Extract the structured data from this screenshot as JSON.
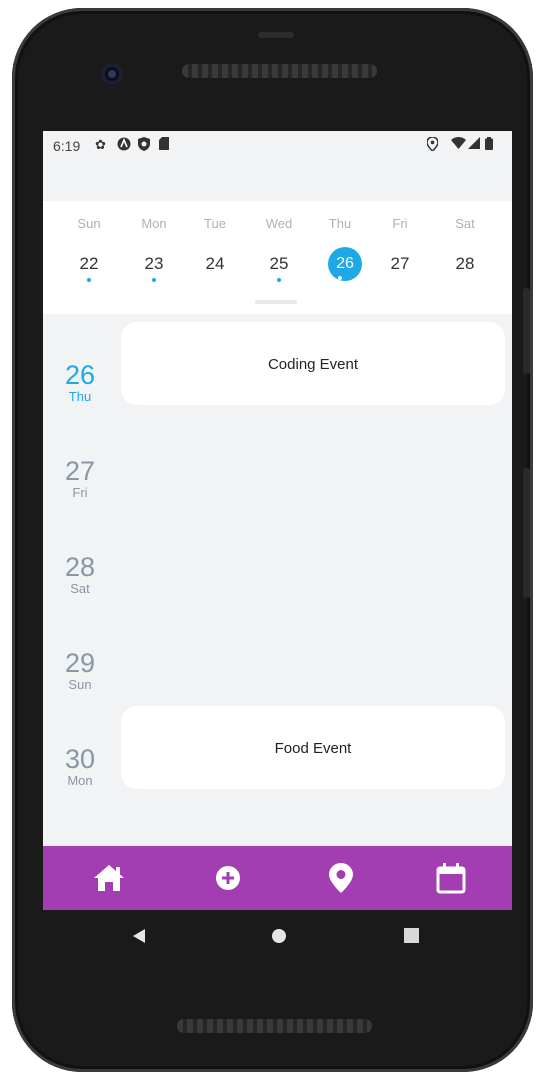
{
  "status_bar": {
    "time": "6:19",
    "left_icons": [
      "settings-icon",
      "notification-a-icon",
      "shield-icon",
      "sd-card-icon"
    ],
    "right_icons": [
      "location-icon",
      "wifi-icon",
      "signal-icon",
      "battery-icon"
    ]
  },
  "week": {
    "days": [
      {
        "dow": "Sun",
        "num": "22",
        "has_event": true,
        "selected": false
      },
      {
        "dow": "Mon",
        "num": "23",
        "has_event": true,
        "selected": false
      },
      {
        "dow": "Tue",
        "num": "24",
        "has_event": false,
        "selected": false
      },
      {
        "dow": "Wed",
        "num": "25",
        "has_event": true,
        "selected": false
      },
      {
        "dow": "Thu",
        "num": "26",
        "has_event": true,
        "selected": true
      },
      {
        "dow": "Fri",
        "num": "27",
        "has_event": false,
        "selected": false
      },
      {
        "dow": "Sat",
        "num": "28",
        "has_event": false,
        "selected": false
      }
    ]
  },
  "agenda": [
    {
      "num": "26",
      "dow": "Thu",
      "today": true,
      "event": "Coding Event"
    },
    {
      "num": "27",
      "dow": "Fri",
      "today": false,
      "event": null
    },
    {
      "num": "28",
      "dow": "Sat",
      "today": false,
      "event": null
    },
    {
      "num": "29",
      "dow": "Sun",
      "today": false,
      "event": null
    },
    {
      "num": "30",
      "dow": "Mon",
      "today": false,
      "event": "Food Event"
    }
  ],
  "bottom_nav": {
    "items": [
      "home-icon",
      "add-circle-icon",
      "location-pin-icon",
      "calendar-icon"
    ]
  },
  "system_nav": [
    "back-icon",
    "home-circle-icon",
    "recents-icon"
  ],
  "colors": {
    "accent": "#1da9e8",
    "nav_bar": "#a23eb1",
    "background": "#f1f3f5",
    "muted_text": "#8a97a6"
  }
}
